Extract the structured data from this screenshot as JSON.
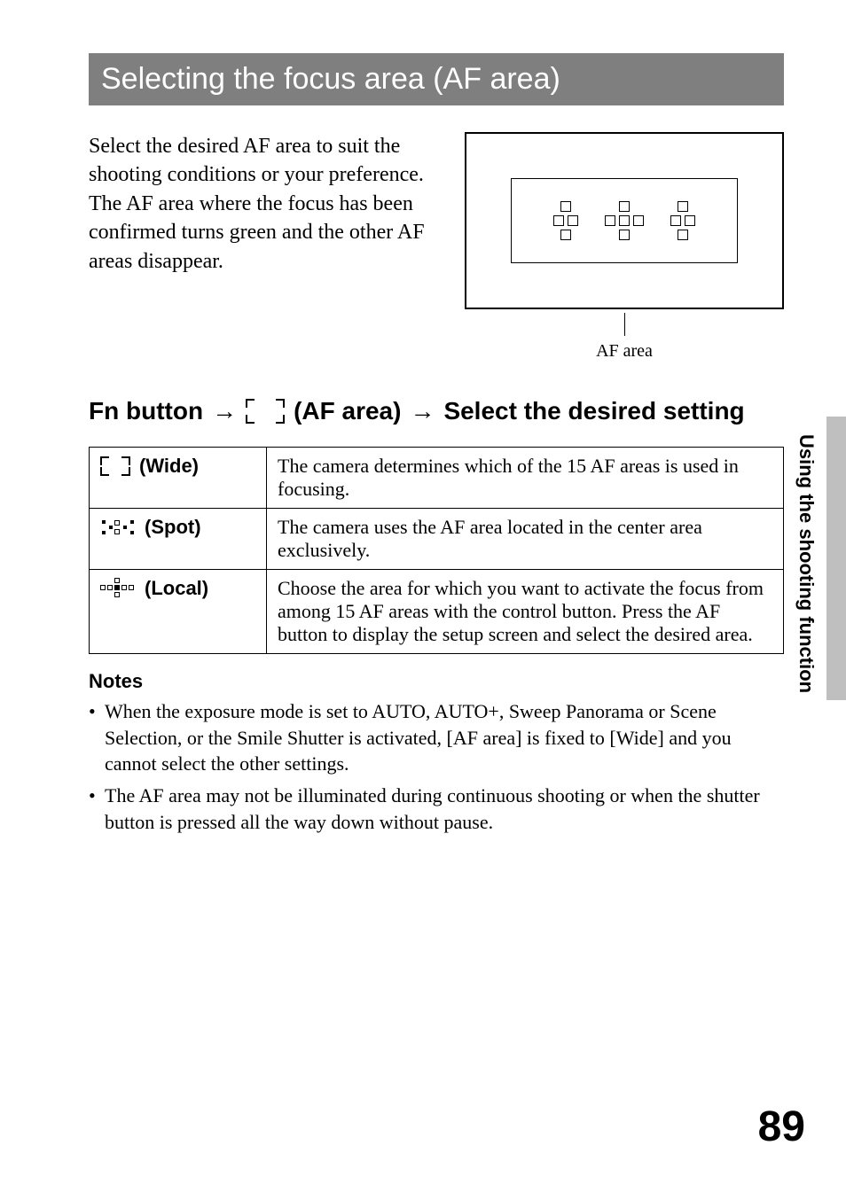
{
  "title": "Selecting the focus area (AF area)",
  "intro": "Select the desired AF area to suit the shooting conditions or your preference. The AF area where the focus has been confirmed turns green and the other AF areas disappear.",
  "diagram_caption": "AF area",
  "path": {
    "prefix": "Fn button",
    "mid": "(AF area)",
    "suffix": "Select the desired setting"
  },
  "options": [
    {
      "label": "(Wide)",
      "desc": "The camera determines which of the 15 AF areas is used in focusing."
    },
    {
      "label": "(Spot)",
      "desc": "The camera uses the AF area located in the center area exclusively."
    },
    {
      "label": "(Local)",
      "desc": "Choose the area for which you want to activate the focus from among 15 AF areas with the control button. Press the AF button to display the setup screen and select the desired area."
    }
  ],
  "notes_heading": "Notes",
  "notes": [
    "When the exposure mode is set to AUTO, AUTO+, Sweep Panorama or Scene Selection, or the Smile Shutter is activated, [AF area] is fixed to [Wide] and you cannot select the other settings.",
    "The AF area may not be illuminated during continuous shooting or when the shutter button is pressed all the way down without pause."
  ],
  "side_text": "Using the shooting function",
  "page_number": "89"
}
